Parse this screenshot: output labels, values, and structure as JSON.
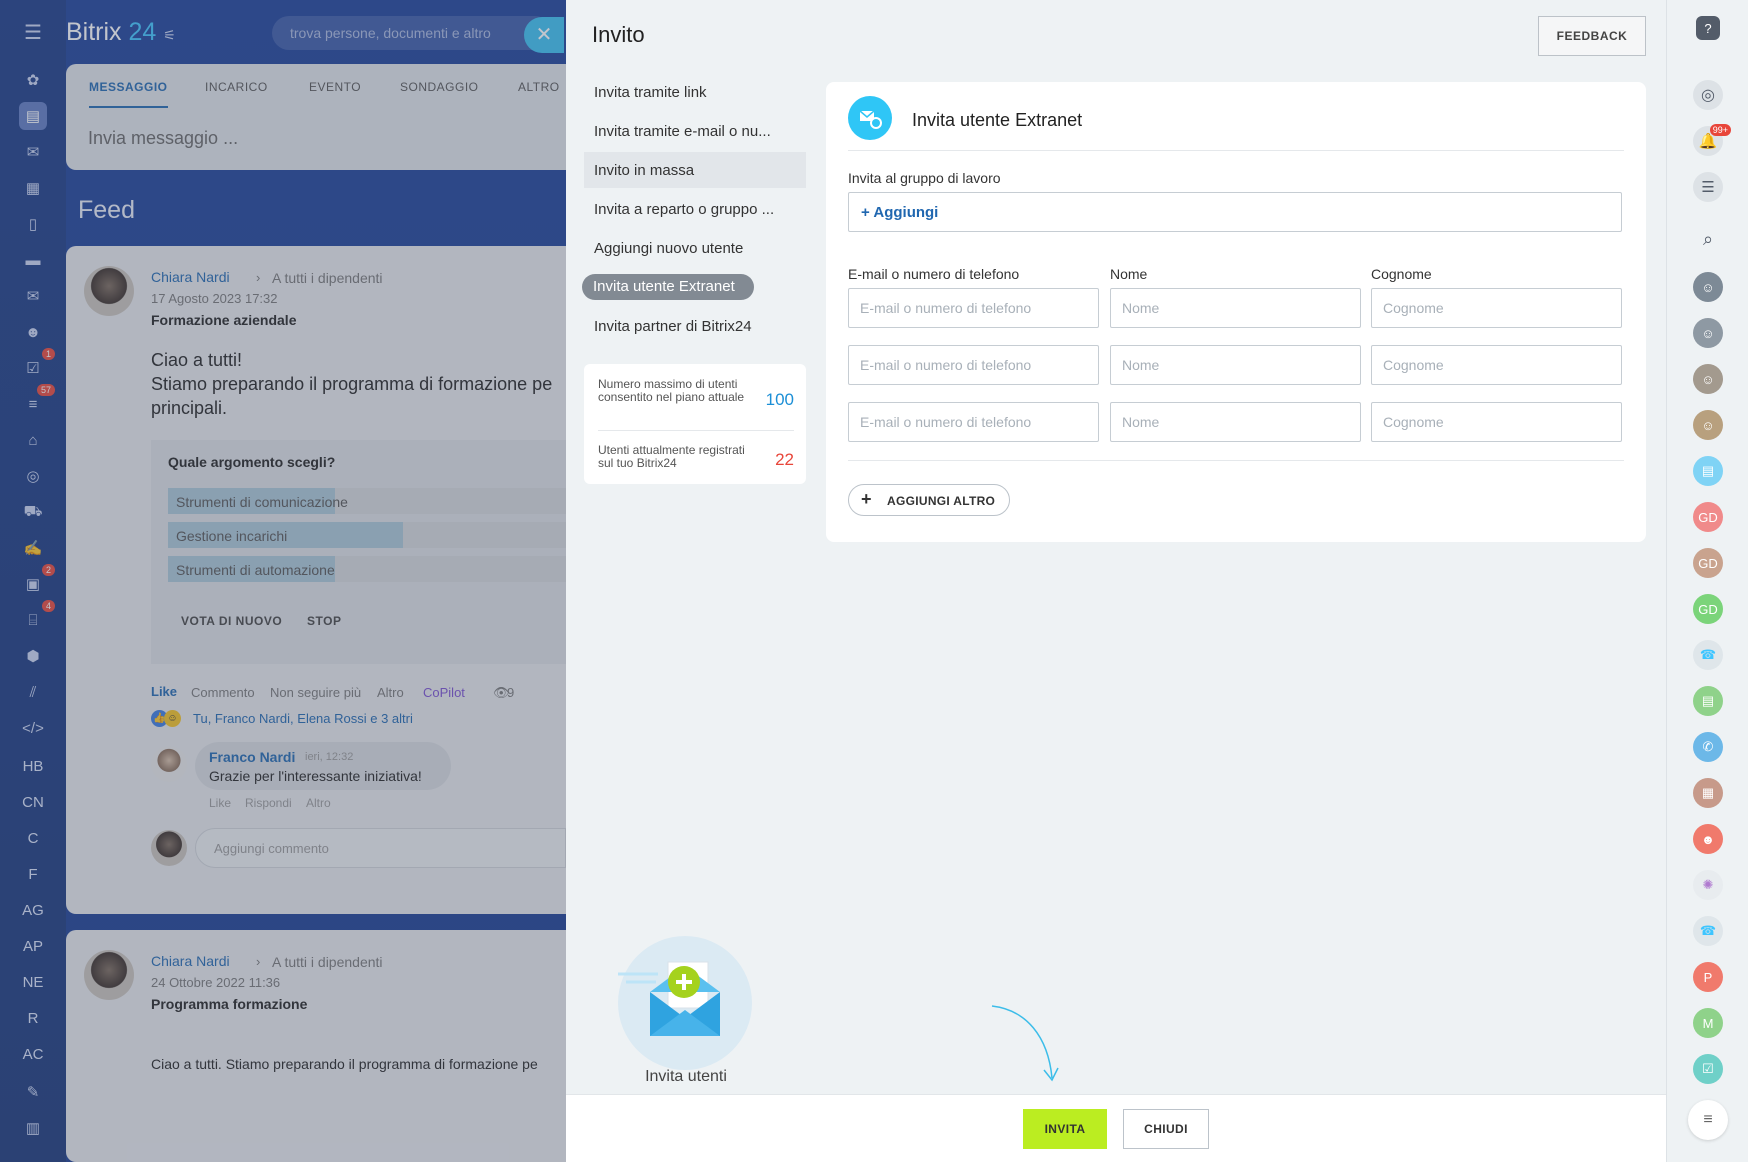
{
  "app": {
    "brand_name": "Bitrix",
    "brand_num": "24",
    "search_placeholder": "trova persone, documenti e altro"
  },
  "leftnav": {
    "badges": {
      "tasks": "1",
      "crm": "57",
      "calendar": "2",
      "sites": "4"
    },
    "text_items": [
      "HB",
      "CN",
      "C",
      "F",
      "AG",
      "AP",
      "NE",
      "R",
      "AC"
    ]
  },
  "postbox": {
    "tabs": [
      "MESSAGGIO",
      "INCARICO",
      "EVENTO",
      "SONDAGGIO",
      "ALTRO"
    ],
    "placeholder": "Invia messaggio ..."
  },
  "feed": {
    "title": "Feed",
    "post1": {
      "author": "Chiara Nardi",
      "audience": "A tutti i dipendenti",
      "date": "17 Agosto 2023 17:32",
      "subject": "Formazione aziendale",
      "body_line1": "Ciao a tutti!",
      "body_line2": "Stiamo preparando il programma di formazione pe",
      "body_line3": "principali.",
      "poll_question": "Quale argomento scegli?",
      "poll_options": [
        "Strumenti di comunicazione",
        "Gestione incarichi",
        "Strumenti di automazione"
      ],
      "poll_option_fractions": [
        0.42,
        0.59,
        0.42
      ],
      "vote_again": "VOTA DI NUOVO",
      "stop": "STOP",
      "actions": {
        "like": "Like",
        "comment": "Commento",
        "unfollow": "Non seguire più",
        "more": "Altro",
        "copilot": "CoPilot",
        "views": "9"
      },
      "likers": "Tu, Franco Nardi, Elena Rossi e 3 altri",
      "comment": {
        "author": "Franco Nardi",
        "time": "ieri, 12:32",
        "text": "Grazie per l'interessante iniziativa!",
        "like": "Like",
        "reply": "Rispondi",
        "more": "Altro"
      },
      "add_comment": "Aggiungi commento"
    },
    "post2": {
      "author": "Chiara Nardi",
      "audience": "A tutti i dipendenti",
      "date": "24 Ottobre 2022 11:36",
      "subject": "Programma formazione",
      "body": "Ciao a tutti. Stiamo preparando il programma di formazione pe"
    }
  },
  "slider": {
    "title": "Invito",
    "feedback": "FEEDBACK",
    "menu": [
      "Invita tramite link",
      "Invita tramite e-mail o nu...",
      "Invito in massa",
      "Invita a reparto o gruppo ...",
      "Aggiungi nuovo utente",
      "Invita utente Extranet",
      "Invita partner di Bitrix24"
    ],
    "stats": {
      "max_label": "Numero massimo di utenti consentito nel piano attuale",
      "max_value": "100",
      "current_label": "Utenti attualmente registrati sul tuo Bitrix24",
      "current_value": "22"
    },
    "form": {
      "title": "Invita utente Extranet",
      "group_label": "Invita al gruppo di lavoro",
      "add_label": "+ Aggiungi",
      "col_email": "E-mail o numero di telefono",
      "col_name": "Nome",
      "col_surname": "Cognome",
      "ph_email": "E-mail o numero di telefono",
      "ph_name": "Nome",
      "ph_surname": "Cognome",
      "add_more": "AGGIUNGI ALTRO"
    },
    "illustration_label": "Invita utenti",
    "invite_btn": "INVITA",
    "close_btn": "CHIUDI"
  },
  "rightbar": {
    "notif_badge": "99+",
    "initials": [
      "GD",
      "GD",
      "GD",
      "P",
      "M"
    ],
    "colors": {
      "gd1": "#f08a8a",
      "gd2": "#c9a38e",
      "gd3": "#7bd47a",
      "p": "#f07a6c",
      "m": "#8fd28a"
    }
  },
  "colors": {
    "accent": "#2067b0",
    "invite": "#bbed21",
    "brand_blue": "#3ec5ff",
    "max_value": "#1c8fd6",
    "current_value": "#e8463a"
  }
}
